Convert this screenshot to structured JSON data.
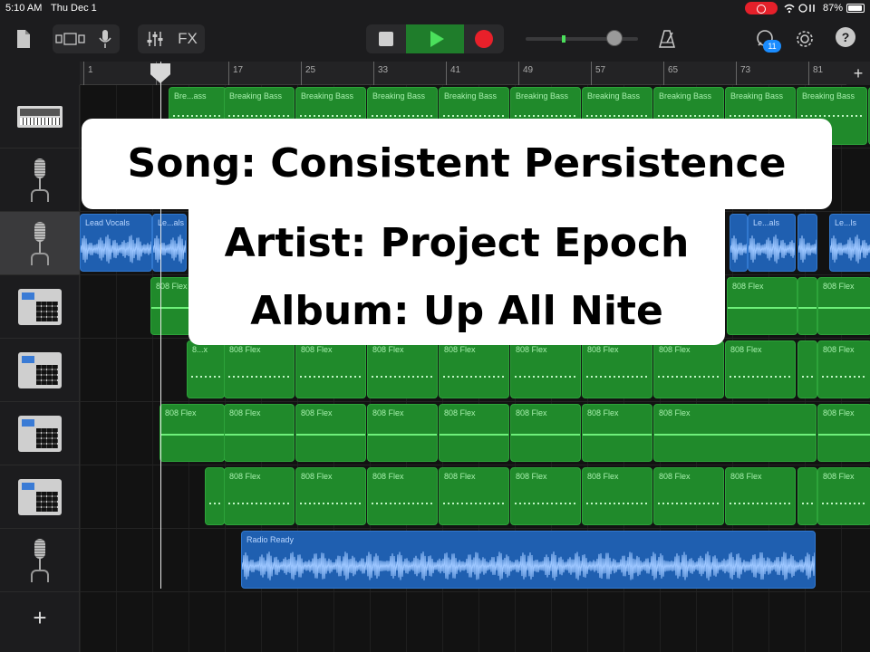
{
  "status_bar": {
    "time": "5:10 AM",
    "date": "Thu Dec 1",
    "battery": "87%"
  },
  "toolbar": {
    "fx_label": "FX",
    "notifications_count": "11",
    "help_label": "?"
  },
  "ruler": {
    "bars": [
      "1",
      "9",
      "17",
      "25",
      "33",
      "41",
      "49",
      "57",
      "65",
      "73",
      "81"
    ],
    "add_label": "+"
  },
  "tracks": [
    {
      "name": "keyboard",
      "icon": "keyboard-icon"
    },
    {
      "name": "vocal-mic",
      "icon": "mic-icon"
    },
    {
      "name": "lead-vocals",
      "icon": "mic-icon"
    },
    {
      "name": "drum-machine-1",
      "icon": "drum-machine-icon"
    },
    {
      "name": "drum-machine-2",
      "icon": "drum-machine-icon"
    },
    {
      "name": "drum-machine-3",
      "icon": "drum-machine-icon"
    },
    {
      "name": "drum-machine-4",
      "icon": "drum-machine-icon"
    },
    {
      "name": "radio-mic",
      "icon": "mic-icon"
    }
  ],
  "regions": {
    "bass_short": "Bre...ass",
    "bass": "Breaking Bass",
    "lead_vocals": "Lead Vocals",
    "le_als": "Le...als",
    "le_ls": "Le...ls",
    "flex": "808 Flex",
    "flex_short": "8...x",
    "radio": "Radio Ready"
  },
  "captions": {
    "song": "Song: Consistent Persistence",
    "artist": "Artist: Project Epoch",
    "album": "Album: Up All Nite"
  },
  "add_track_label": "+",
  "colors": {
    "green_region": "#208a2b",
    "blue_region": "#1f5fb0",
    "play": "#4be05c",
    "record": "#e8202a"
  }
}
